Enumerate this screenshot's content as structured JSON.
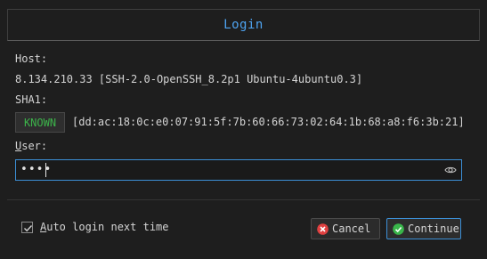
{
  "dialog": {
    "title": "Login"
  },
  "host": {
    "label": "Host:",
    "value": "8.134.210.33 [SSH-2.0-OpenSSH_8.2p1 Ubuntu-4ubuntu0.3]"
  },
  "sha1": {
    "label": "SHA1:",
    "badge": "KNOWN",
    "fingerprint": "[dd:ac:18:0c:e0:07:91:5f:7b:60:66:73:02:64:1b:68:a8:f6:3b:21]"
  },
  "user": {
    "label": "User:",
    "value": "••••",
    "reveal_icon": "eye-icon"
  },
  "auto_login": {
    "label": "Auto login next time",
    "checked": true
  },
  "buttons": {
    "cancel_label": "Cancel",
    "continue_label": "Continue"
  },
  "colors": {
    "accent": "#4ea3f0",
    "known_green": "#3cb34a",
    "cancel_red": "#e04040",
    "continue_green": "#39b54a"
  }
}
